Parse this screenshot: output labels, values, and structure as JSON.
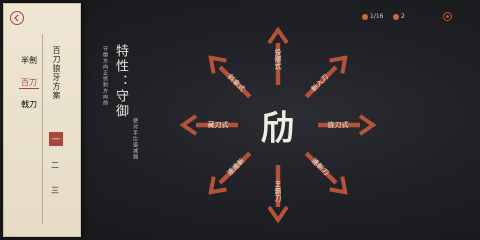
{
  "panel": {
    "tabs": [
      {
        "label": "半劍",
        "active": false
      },
      {
        "label": "百刀",
        "active": true
      },
      {
        "label": "戟刀",
        "active": false
      }
    ],
    "heading": "百刀狼牙方案",
    "items": [
      "一",
      "二",
      "三"
    ]
  },
  "hud": {
    "stat_a": "1/16",
    "stat_b": "2",
    "accent_color": "#b5523a"
  },
  "trait": {
    "title": "特性：守御",
    "desc_1": "守御方向正劈刺方向前",
    "desc_2": "使对手比值减弱"
  },
  "center": {
    "glyph": "劤"
  },
  "moves": [
    {
      "label": "投擲式"
    },
    {
      "label": "斬入刀"
    },
    {
      "label": "旋刀式"
    },
    {
      "label": "連斬刀"
    },
    {
      "label": "王霸刀"
    },
    {
      "label": "連連斬"
    },
    {
      "label": "藏刀式"
    },
    {
      "label": "斜拿式"
    }
  ]
}
